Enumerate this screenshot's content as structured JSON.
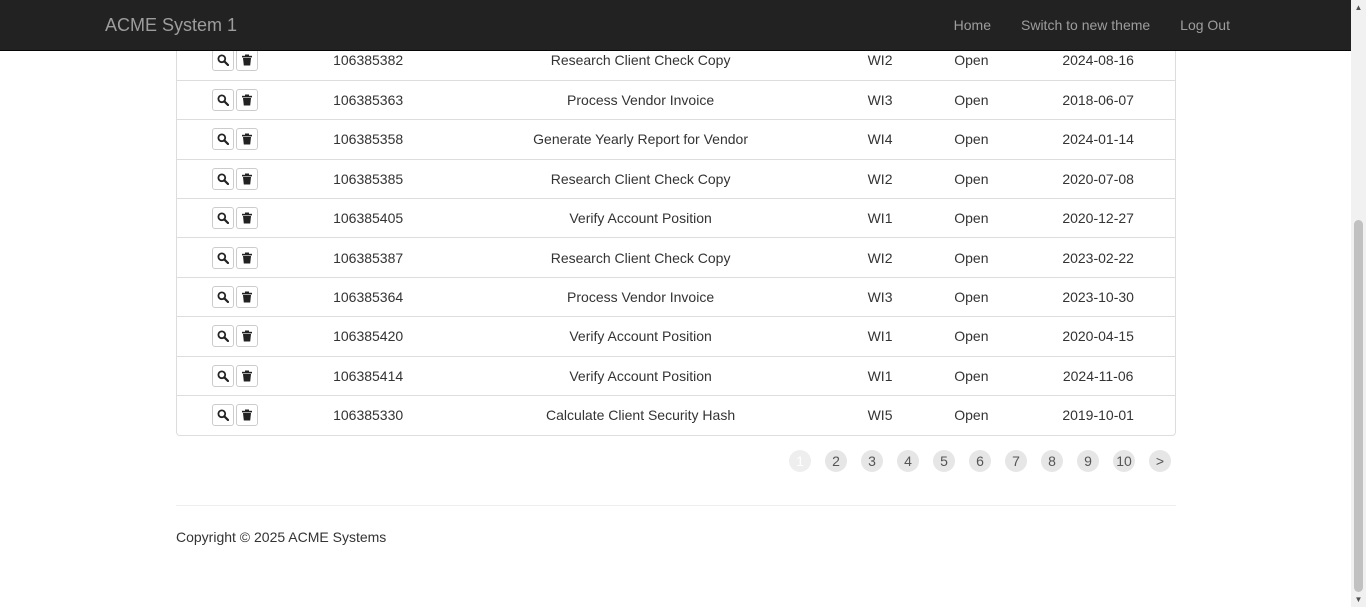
{
  "navbar": {
    "brand": "ACME System 1",
    "links": [
      "Home",
      "Switch to new theme",
      "Log Out"
    ]
  },
  "table": {
    "rows": [
      {
        "id": "106385382",
        "description": "Research Client Check Copy",
        "type": "WI2",
        "status": "Open",
        "date": "2024-08-16"
      },
      {
        "id": "106385363",
        "description": "Process Vendor Invoice",
        "type": "WI3",
        "status": "Open",
        "date": "2018-06-07"
      },
      {
        "id": "106385358",
        "description": "Generate Yearly Report for Vendor",
        "type": "WI4",
        "status": "Open",
        "date": "2024-01-14"
      },
      {
        "id": "106385385",
        "description": "Research Client Check Copy",
        "type": "WI2",
        "status": "Open",
        "date": "2020-07-08"
      },
      {
        "id": "106385405",
        "description": "Verify Account Position",
        "type": "WI1",
        "status": "Open",
        "date": "2020-12-27"
      },
      {
        "id": "106385387",
        "description": "Research Client Check Copy",
        "type": "WI2",
        "status": "Open",
        "date": "2023-02-22"
      },
      {
        "id": "106385364",
        "description": "Process Vendor Invoice",
        "type": "WI3",
        "status": "Open",
        "date": "2023-10-30"
      },
      {
        "id": "106385420",
        "description": "Verify Account Position",
        "type": "WI1",
        "status": "Open",
        "date": "2020-04-15"
      },
      {
        "id": "106385414",
        "description": "Verify Account Position",
        "type": "WI1",
        "status": "Open",
        "date": "2024-11-06"
      },
      {
        "id": "106385330",
        "description": "Calculate Client Security Hash",
        "type": "WI5",
        "status": "Open",
        "date": "2019-10-01"
      }
    ],
    "row_actions": [
      "search-icon",
      "trash-icon"
    ]
  },
  "pagination": {
    "pages": [
      "1",
      "2",
      "3",
      "4",
      "5",
      "6",
      "7",
      "8",
      "9",
      "10"
    ],
    "current": "1",
    "next": ">"
  },
  "footer": {
    "copyright": "Copyright © 2025 ACME Systems"
  }
}
